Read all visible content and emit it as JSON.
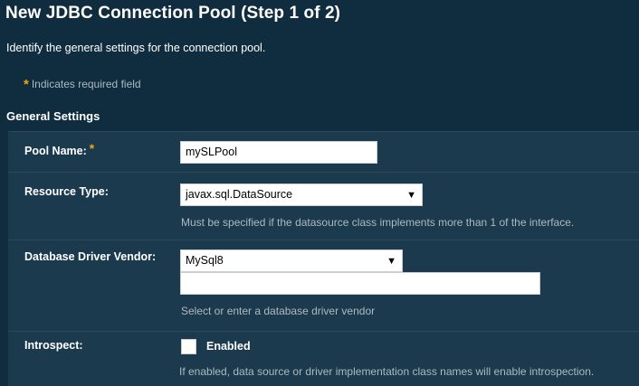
{
  "page": {
    "title": "New JDBC Connection Pool (Step 1 of 2)",
    "description": "Identify the general settings for the connection pool.",
    "required_note": "Indicates required field",
    "required_marker": "*",
    "section_title": "General Settings"
  },
  "form": {
    "pool_name": {
      "label": "Pool Name:",
      "required_marker": "*",
      "value": "mySLPool"
    },
    "resource_type": {
      "label": "Resource Type:",
      "value": "javax.sql.DataSource",
      "help": "Must be specified if the datasource class implements more than 1 of the interface."
    },
    "db_vendor": {
      "label": "Database Driver Vendor:",
      "value": "MySql8",
      "custom_value": "",
      "help": "Select or enter a database driver vendor"
    },
    "introspect": {
      "label": "Introspect:",
      "checkbox_label": "Enabled",
      "checked": false,
      "help": "If enabled, data source or driver implementation class names will enable introspection."
    }
  },
  "icons": {
    "dropdown": "chevron-down-icon",
    "required": "asterisk-icon"
  },
  "colors": {
    "background": "#0f2d3f",
    "panel": "#1b3a4d",
    "required_star": "#f0a21a",
    "help_text": "#aeb9c0"
  }
}
